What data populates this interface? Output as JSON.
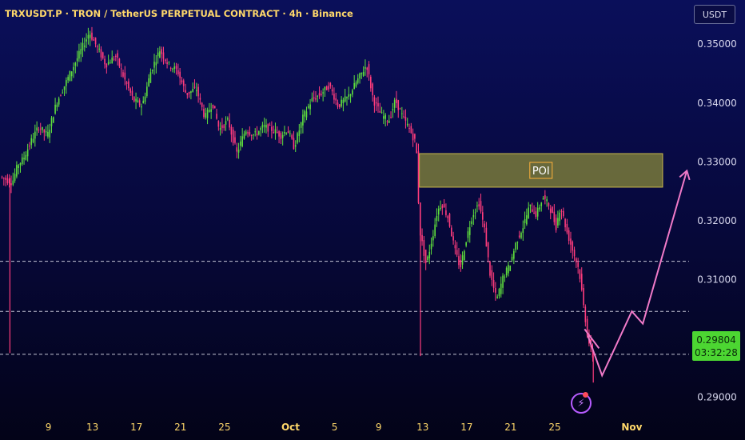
{
  "header": {
    "title": "TRXUSDT.P · TRON / TetherUS PERPETUAL CONTRACT · 4h · Binance"
  },
  "unit_button": "USDT",
  "current_price": {
    "value": "0.29804",
    "countdown": "03:32:28"
  },
  "colors": {
    "up": "#5fe03d",
    "down": "#ff3c7d",
    "axis_text": "#d8d8ee",
    "date_text": "#ffd86a",
    "poi_box": "#8a8a3a",
    "projection": "#f07ac8"
  },
  "chart_data": {
    "type": "candlestick",
    "timeframe": "4h",
    "ylim": [
      0.2875,
      0.3575
    ],
    "y_ticks": [
      0.35,
      0.34,
      0.33,
      0.32,
      0.31,
      0.3,
      0.29
    ],
    "y_tick_labels": [
      "0.35000",
      "0.34000",
      "0.33000",
      "0.32000",
      "0.31000",
      "0.30000",
      "0.29000"
    ],
    "x_ticks": [
      {
        "label": "9",
        "day": 9
      },
      {
        "label": "13",
        "day": 13
      },
      {
        "label": "17",
        "day": 17
      },
      {
        "label": "21",
        "day": 21
      },
      {
        "label": "25",
        "day": 25
      },
      {
        "label": "Oct",
        "day": 31
      },
      {
        "label": "5",
        "day": 35
      },
      {
        "label": "9",
        "day": 39
      },
      {
        "label": "13",
        "day": 43
      },
      {
        "label": "17",
        "day": 47
      },
      {
        "label": "21",
        "day": 51
      },
      {
        "label": "25",
        "day": 55
      },
      {
        "label": "Nov",
        "day": 62
      }
    ],
    "xlim": [
      4.6,
      67.2
    ],
    "price_path": [
      [
        4.7,
        0.3275
      ],
      [
        5.8,
        0.3265
      ],
      [
        6.3,
        0.3295
      ],
      [
        6.8,
        0.3305
      ],
      [
        7.5,
        0.3335
      ],
      [
        8.2,
        0.336
      ],
      [
        9.0,
        0.3345
      ],
      [
        9.8,
        0.34
      ],
      [
        10.8,
        0.344
      ],
      [
        11.8,
        0.348
      ],
      [
        12.8,
        0.352
      ],
      [
        13.5,
        0.3495
      ],
      [
        14.3,
        0.3465
      ],
      [
        15.2,
        0.348
      ],
      [
        16.0,
        0.344
      ],
      [
        16.8,
        0.3405
      ],
      [
        17.6,
        0.3395
      ],
      [
        18.4,
        0.3455
      ],
      [
        19.2,
        0.349
      ],
      [
        20.0,
        0.3465
      ],
      [
        20.8,
        0.3455
      ],
      [
        21.6,
        0.3415
      ],
      [
        22.5,
        0.3425
      ],
      [
        23.3,
        0.3375
      ],
      [
        24.0,
        0.34
      ],
      [
        24.6,
        0.3355
      ],
      [
        25.4,
        0.337
      ],
      [
        26.2,
        0.3315
      ],
      [
        27.0,
        0.3355
      ],
      [
        27.8,
        0.3345
      ],
      [
        28.6,
        0.336
      ],
      [
        29.4,
        0.3355
      ],
      [
        30.2,
        0.3345
      ],
      [
        30.8,
        0.3355
      ],
      [
        31.4,
        0.3325
      ],
      [
        32.2,
        0.3375
      ],
      [
        33.0,
        0.3405
      ],
      [
        33.8,
        0.3415
      ],
      [
        34.6,
        0.343
      ],
      [
        35.4,
        0.3395
      ],
      [
        36.3,
        0.341
      ],
      [
        37.2,
        0.344
      ],
      [
        38.0,
        0.3465
      ],
      [
        38.6,
        0.3405
      ],
      [
        39.3,
        0.338
      ],
      [
        40.0,
        0.337
      ],
      [
        40.6,
        0.3405
      ],
      [
        41.3,
        0.3375
      ],
      [
        41.9,
        0.3355
      ],
      [
        42.5,
        0.333
      ],
      [
        42.8,
        0.3185
      ],
      [
        43.4,
        0.3125
      ],
      [
        44.0,
        0.3175
      ],
      [
        44.4,
        0.3215
      ],
      [
        44.8,
        0.323
      ],
      [
        45.4,
        0.3205
      ],
      [
        46.0,
        0.315
      ],
      [
        46.5,
        0.312
      ],
      [
        47.0,
        0.3165
      ],
      [
        47.6,
        0.321
      ],
      [
        48.2,
        0.323
      ],
      [
        48.7,
        0.3185
      ],
      [
        49.2,
        0.311
      ],
      [
        49.8,
        0.3065
      ],
      [
        50.4,
        0.3105
      ],
      [
        51.0,
        0.3125
      ],
      [
        51.6,
        0.3165
      ],
      [
        52.2,
        0.319
      ],
      [
        52.8,
        0.3225
      ],
      [
        53.4,
        0.321
      ],
      [
        54.0,
        0.324
      ],
      [
        54.6,
        0.3225
      ],
      [
        55.2,
        0.319
      ],
      [
        55.6,
        0.3225
      ],
      [
        56.2,
        0.318
      ],
      [
        56.8,
        0.3145
      ],
      [
        57.3,
        0.3115
      ],
      [
        57.7,
        0.3055
      ],
      [
        58.1,
        0.3
      ],
      [
        58.5,
        0.297
      ]
    ],
    "wicks": [
      {
        "day": 5.5,
        "low": 0.2975
      },
      {
        "day": 42.8,
        "low": 0.297
      },
      {
        "day": 58.5,
        "low": 0.2925
      }
    ],
    "poi_zone": {
      "label": "POI",
      "x": [
        42.7,
        64.8
      ],
      "y": [
        0.3257,
        0.3314
      ]
    },
    "horizontal_levels": [
      0.3131,
      0.3046,
      0.2973
    ],
    "projection_path": [
      [
        58.0,
        0.3005
      ],
      [
        59.3,
        0.2937
      ],
      [
        62.0,
        0.3046
      ],
      [
        63.0,
        0.3025
      ],
      [
        67.0,
        0.3285
      ]
    ]
  }
}
